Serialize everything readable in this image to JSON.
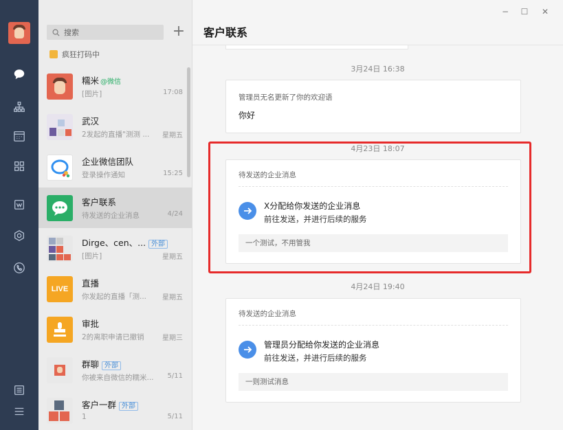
{
  "window": {
    "title": "客户联系",
    "minimize": "−",
    "maximize": "☐",
    "close": "✕"
  },
  "sidebar": {
    "icons": [
      "message-icon",
      "org-chart-icon",
      "calendar-icon",
      "apps-grid-icon",
      "doc-icon",
      "cube-icon",
      "phone-icon",
      "settings-list-icon",
      "menu-icon"
    ]
  },
  "search": {
    "placeholder": "搜索"
  },
  "status_text": "疯狂打码中",
  "conversations": [
    {
      "name": "糯米",
      "tag_wx": "@微信",
      "tag_ext": "",
      "sub": "[图片]",
      "time": "17:08"
    },
    {
      "name": "武汉",
      "tag_wx": "",
      "tag_ext": "",
      "sub": "2发起的直播\"测测 ...",
      "time": "星期五"
    },
    {
      "name": "企业微信团队",
      "tag_wx": "",
      "tag_ext": "",
      "sub": "登录操作通知",
      "time": "15:25"
    },
    {
      "name": "客户联系",
      "tag_wx": "",
      "tag_ext": "",
      "sub": "待发送的企业消息",
      "time": "4/24"
    },
    {
      "name": "Dirge、cen、...",
      "tag_wx": "",
      "tag_ext": "外部",
      "sub": "[图片]",
      "time": "星期五"
    },
    {
      "name": "直播",
      "tag_wx": "",
      "tag_ext": "",
      "sub": "你发起的直播「测...",
      "time": "星期五",
      "badge": "LIVE"
    },
    {
      "name": "审批",
      "tag_wx": "",
      "tag_ext": "",
      "sub": "2的离职申请已撤销",
      "time": "星期三"
    },
    {
      "name": "群聊",
      "tag_wx": "",
      "tag_ext": "外部",
      "sub": "你被来自微信的糯米...",
      "time": "5/11"
    },
    {
      "name": "客户一群",
      "tag_wx": "",
      "tag_ext": "外部",
      "sub": "1",
      "time": "5/11"
    }
  ],
  "messages": [
    {
      "timestamp": "3月24日 16:38",
      "title": "管理员无名更新了你的欢迎语",
      "body": "你好"
    },
    {
      "timestamp": "4月23日 18:07",
      "title": "待发送的企业消息",
      "line1": "X分配给你发送的企业消息",
      "line2": "前往发送，并进行后续的服务",
      "note": "一个测试，不用管我"
    },
    {
      "timestamp": "4月24日 19:40",
      "title": "待发送的企业消息",
      "line1": "管理员分配给你发送的企业消息",
      "line2": "前往发送，并进行后续的服务",
      "note": "一则测试消息"
    }
  ],
  "colors": {
    "rail": "#2e3c52",
    "accent": "#4a8fe8",
    "highlight": "#e62a2a",
    "wecom_green": "#2aae67"
  }
}
